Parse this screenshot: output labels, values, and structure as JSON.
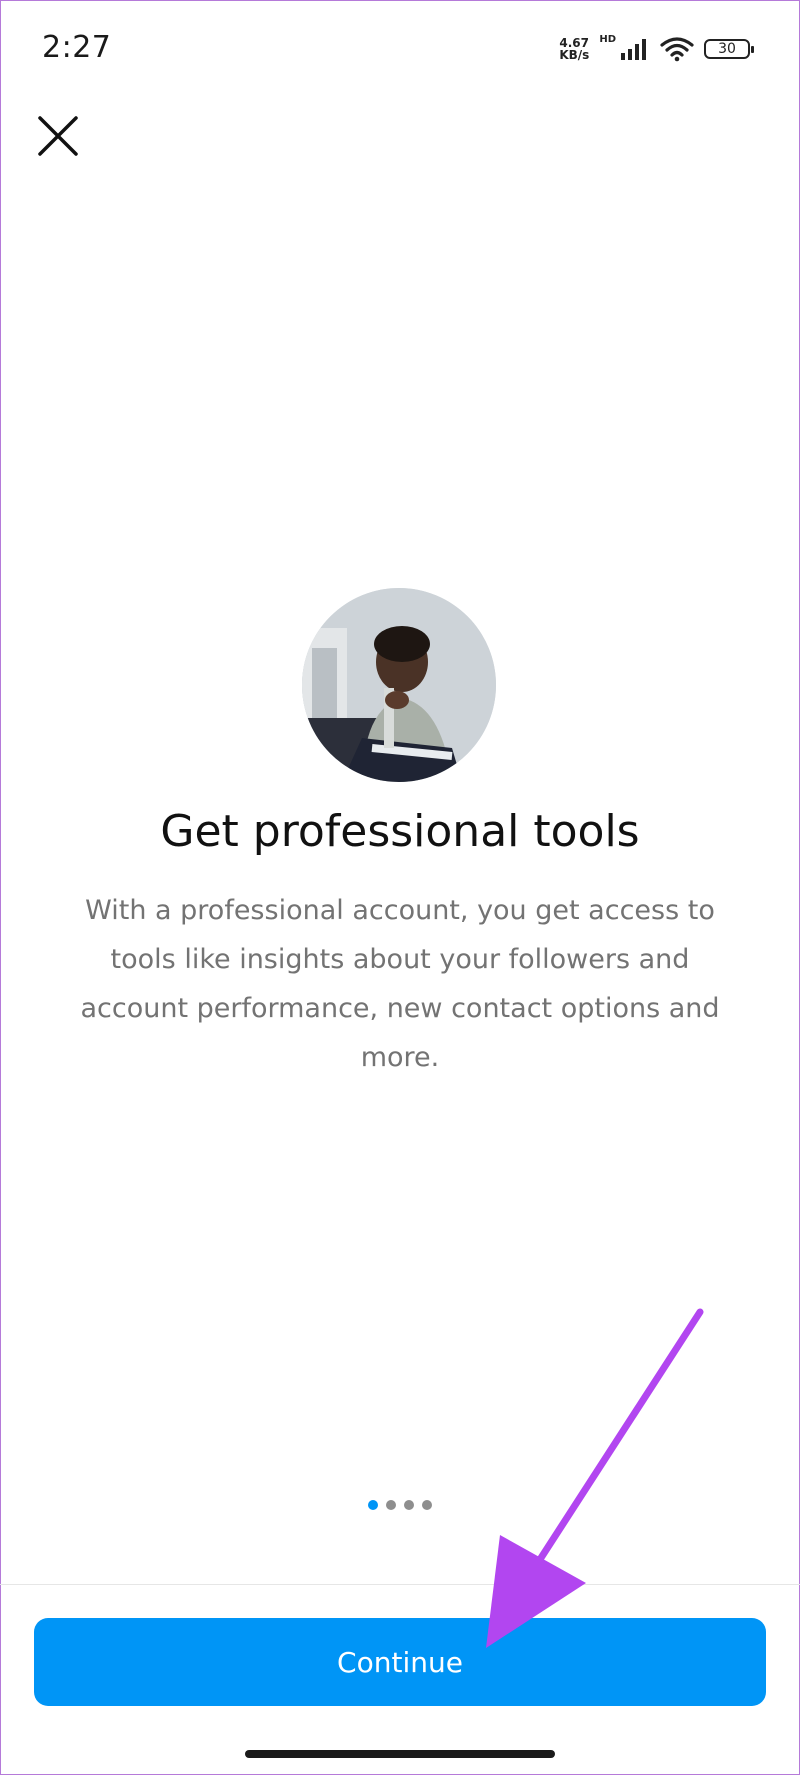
{
  "status_bar": {
    "time": "2:27",
    "net_speed_value": "4.67",
    "net_speed_unit": "KB/s",
    "hd_label": "HD",
    "battery": "30"
  },
  "close_icon": "close-icon",
  "intro": {
    "title": "Get professional tools",
    "description": "With a professional account, you get access to tools like insights about your followers and account performance, new contact options and more."
  },
  "pager": {
    "total": 4,
    "active_index": 0
  },
  "footer": {
    "continue_label": "Continue"
  },
  "colors": {
    "accent": "#0095f6",
    "annotation_arrow": "#b246f0",
    "frame_border": "#b57ad9"
  }
}
